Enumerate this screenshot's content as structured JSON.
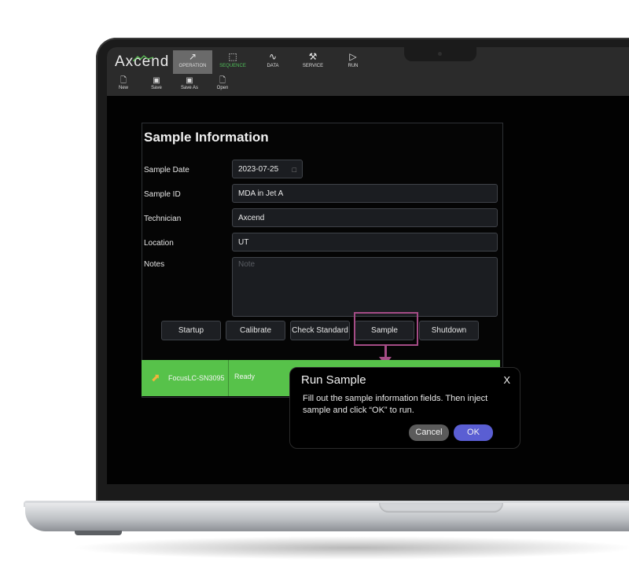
{
  "app": {
    "logo": "Axcend",
    "nav_tabs": [
      {
        "label": "OPERATION",
        "icon": "operation-icon"
      },
      {
        "label": "SEQUENCE",
        "icon": "sequence-icon"
      },
      {
        "label": "DATA",
        "icon": "data-icon"
      },
      {
        "label": "SERVICE",
        "icon": "wrench-icon"
      },
      {
        "label": "RUN",
        "icon": "play-icon"
      }
    ],
    "toolbar": [
      {
        "label": "New",
        "icon": "new-file-icon"
      },
      {
        "label": "Save",
        "icon": "save-icon"
      },
      {
        "label": "Save As",
        "icon": "save-as-icon"
      },
      {
        "label": "Open",
        "icon": "open-file-icon"
      }
    ]
  },
  "sample_info": {
    "title": "Sample Information",
    "fields": {
      "sample_date": {
        "label": "Sample Date",
        "value": "2023-07-25"
      },
      "sample_id": {
        "label": "Sample ID",
        "value": "MDA in Jet A"
      },
      "technician": {
        "label": "Technician",
        "value": "Axcend"
      },
      "location": {
        "label": "Location",
        "value": "UT"
      },
      "notes": {
        "label": "Notes",
        "placeholder": "Note"
      }
    },
    "buttons": [
      "Startup",
      "Calibrate",
      "Check Standard",
      "Sample",
      "Shutdown"
    ]
  },
  "status_bar": {
    "device": "FocusLC-SN3095",
    "status": "Ready"
  },
  "dialog": {
    "title": "Run Sample",
    "close": "X",
    "message": "Fill out the sample information fields.  Then inject sample and click “OK” to run.",
    "cancel": "Cancel",
    "ok": "OK"
  },
  "colors": {
    "status_green": "#57c24a",
    "highlight": "#a54c86",
    "ok_button": "#5a5ed3",
    "active_tab": "#6a6a6a",
    "sequence_tab_text": "#4fbf5a"
  }
}
